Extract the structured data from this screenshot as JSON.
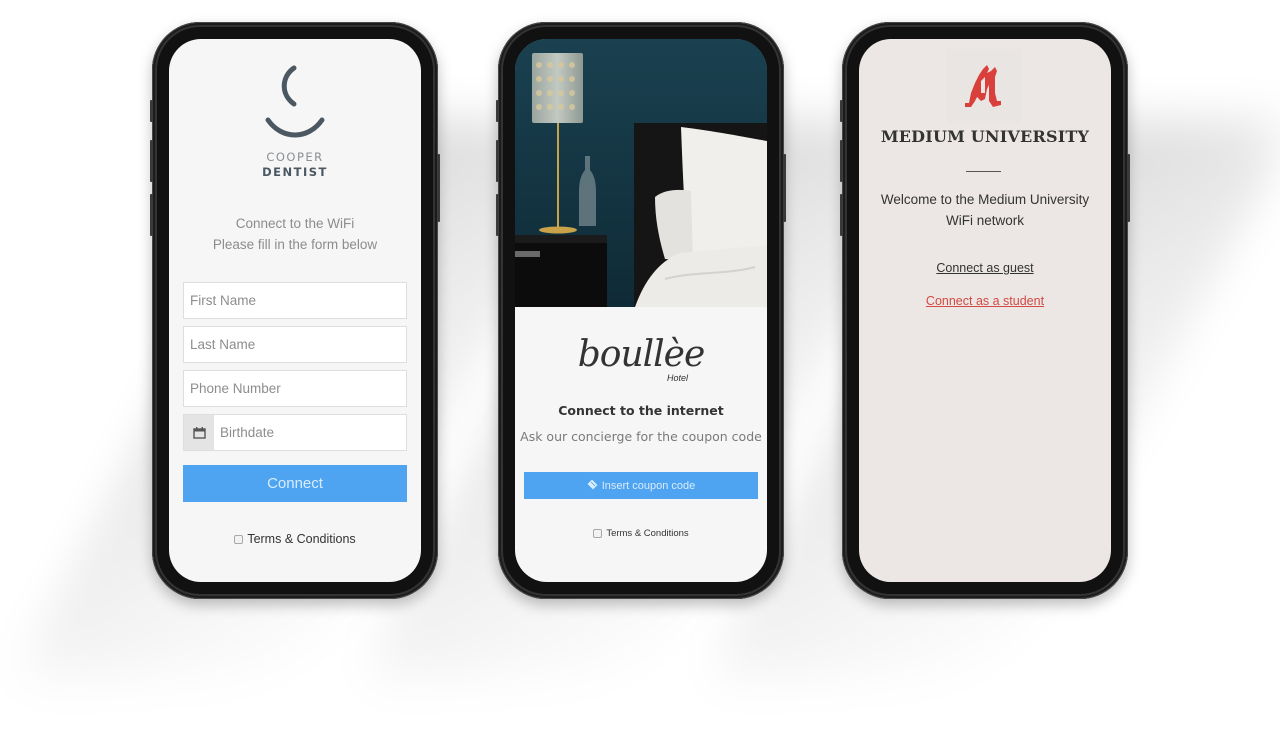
{
  "phones": [
    {
      "brand": {
        "line1": "COOPER",
        "line2": "DENTIST",
        "color": "#4b5862"
      },
      "intro": {
        "line1": "Connect to the WiFi",
        "line2": "Please fill in the form below"
      },
      "fields": [
        {
          "placeholder": "First Name",
          "value": ""
        },
        {
          "placeholder": "Last Name",
          "value": ""
        },
        {
          "placeholder": "Phone Number",
          "value": ""
        },
        {
          "placeholder": "Birthdate",
          "value": "",
          "icon": "calendar-icon"
        }
      ],
      "connect_label": "Connect",
      "terms_label": "Terms & Conditions",
      "terms_checked": false,
      "accent": "#4ea4f0"
    },
    {
      "hero_image": "bedroom-photo",
      "brand": {
        "name": "boullèe",
        "sub": "Hotel"
      },
      "title": "Connect to the internet",
      "subtitle": "Ask our concierge for the coupon code",
      "coupon_button": {
        "label": "Insert coupon code",
        "icon": "ticket-icon"
      },
      "terms_label": "Terms & Conditions",
      "terms_checked": false,
      "accent": "#4ea4f0"
    },
    {
      "logo": "blackletter-m-logo",
      "title": "MEDIUM UNIVERSITY",
      "welcome": {
        "line1": "Welcome to the Medium University",
        "line2": "WiFi network"
      },
      "links": [
        {
          "label": "Connect as guest",
          "color": "#333333"
        },
        {
          "label": "Connect as a student",
          "color": "#d24a43"
        }
      ],
      "accent": "#d24a43",
      "background": "#ece7e4"
    }
  ]
}
